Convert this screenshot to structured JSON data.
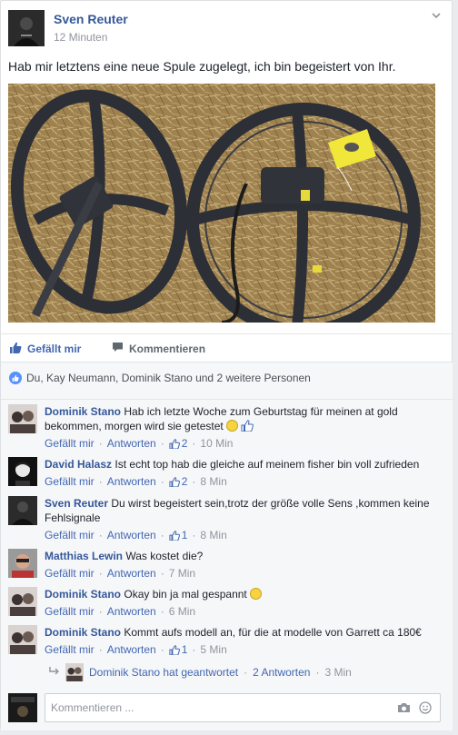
{
  "post": {
    "author": "Sven Reuter",
    "timestamp": "12 Minuten",
    "text": "Hab mir letztens eine neue Spule zugelegt, ich bin begeistert von Ihr."
  },
  "actions": {
    "like_label": "Gefällt mir",
    "comment_label": "Kommentieren"
  },
  "likes_summary": "Du, Kay Neumann, Dominik Stano und 2 weitere Personen",
  "comments": [
    {
      "name": "Dominik Stano",
      "text": "Hab ich letzte Woche zum Geburtstag für meinen at gold bekommen, morgen wird sie getestet",
      "like": "Gefällt mir",
      "reply": "Antworten",
      "likes": "2",
      "time": "10 Min",
      "avatar_icon": "avatar-people-icon"
    },
    {
      "name": "David Halasz",
      "text": "Ist echt top hab die gleiche auf meinem fisher bin voll zufrieden",
      "like": "Gefällt mir",
      "reply": "Antworten",
      "likes": "2",
      "time": "8 Min",
      "avatar_icon": "avatar-person-dark-icon"
    },
    {
      "name": "Sven Reuter",
      "text": "Du wirst begeistert sein,trotz der größe volle Sens ,kommen keine Fehlsignale",
      "like": "Gefällt mir",
      "reply": "Antworten",
      "likes": "1",
      "time": "8 Min",
      "avatar_icon": "avatar-person-dark-icon"
    },
    {
      "name": "Matthias Lewin",
      "text": "Was kostet die?",
      "like": "Gefällt mir",
      "reply": "Antworten",
      "likes": "",
      "time": "7 Min",
      "avatar_icon": "avatar-person-red-icon"
    },
    {
      "name": "Dominik Stano",
      "text": "Okay bin ja mal gespannt",
      "like": "Gefällt mir",
      "reply": "Antworten",
      "likes": "",
      "time": "6 Min",
      "avatar_icon": "avatar-people-icon"
    },
    {
      "name": "Dominik Stano",
      "text": "Kommt aufs modell an, für die at modelle von Garrett ca 180€",
      "like": "Gefällt mir",
      "reply": "Antworten",
      "likes": "1",
      "time": "5 Min",
      "avatar_icon": "avatar-people-icon"
    }
  ],
  "reply_summary": {
    "text": "Dominik Stano hat geantwortet",
    "count": "2 Antworten",
    "time": "3 Min"
  },
  "composer": {
    "placeholder": "Kommentieren ..."
  },
  "colors": {
    "link": "#365899",
    "accent": "#4267b2",
    "meta": "#90949c"
  }
}
